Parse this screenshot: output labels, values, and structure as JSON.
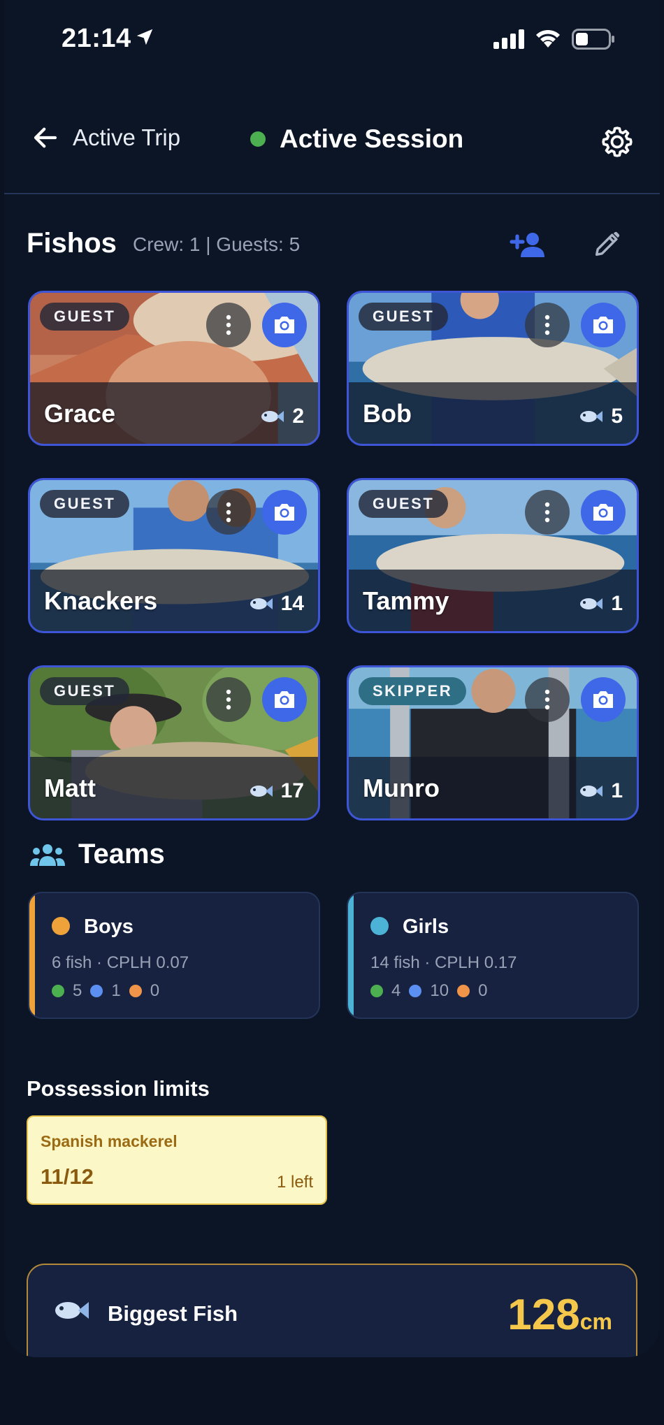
{
  "status_bar": {
    "time": "21:14"
  },
  "header": {
    "back_label": "Active Trip",
    "session_label": "Active Session",
    "session_color": "#4caf50"
  },
  "fishos": {
    "title": "Fishos",
    "summary": "Crew: 1 | Guests: 5",
    "cards": [
      {
        "name": "Grace",
        "role": "GUEST",
        "count": "2"
      },
      {
        "name": "Bob",
        "role": "GUEST",
        "count": "5"
      },
      {
        "name": "Knackers",
        "role": "GUEST",
        "count": "14"
      },
      {
        "name": "Tammy",
        "role": "GUEST",
        "count": "1"
      },
      {
        "name": "Matt",
        "role": "GUEST",
        "count": "17"
      },
      {
        "name": "Munro",
        "role": "SKIPPER",
        "count": "1"
      }
    ]
  },
  "teams": {
    "title": "Teams",
    "items": [
      {
        "name": "Boys",
        "color": "#f0a23a",
        "stats": "6 fish · CPLH 0.07",
        "breakdown": [
          "5",
          "1",
          "0"
        ]
      },
      {
        "name": "Girls",
        "color": "#4db3d6",
        "stats": "14 fish · CPLH 0.17",
        "breakdown": [
          "4",
          "10",
          "0"
        ]
      }
    ],
    "breakdown_colors": [
      "#4caf50",
      "#5b8ff2",
      "#f0944a"
    ]
  },
  "possession": {
    "title": "Possession limits",
    "items": [
      {
        "species": "Spanish mackerel",
        "count": "11/12",
        "left": "1 left"
      }
    ]
  },
  "biggest_fish": {
    "label": "Biggest Fish",
    "value": "128",
    "unit": "cm"
  },
  "colors": {
    "accent": "#3f68e8",
    "gold": "#f5c84c",
    "card_border": "#3d55d6"
  }
}
